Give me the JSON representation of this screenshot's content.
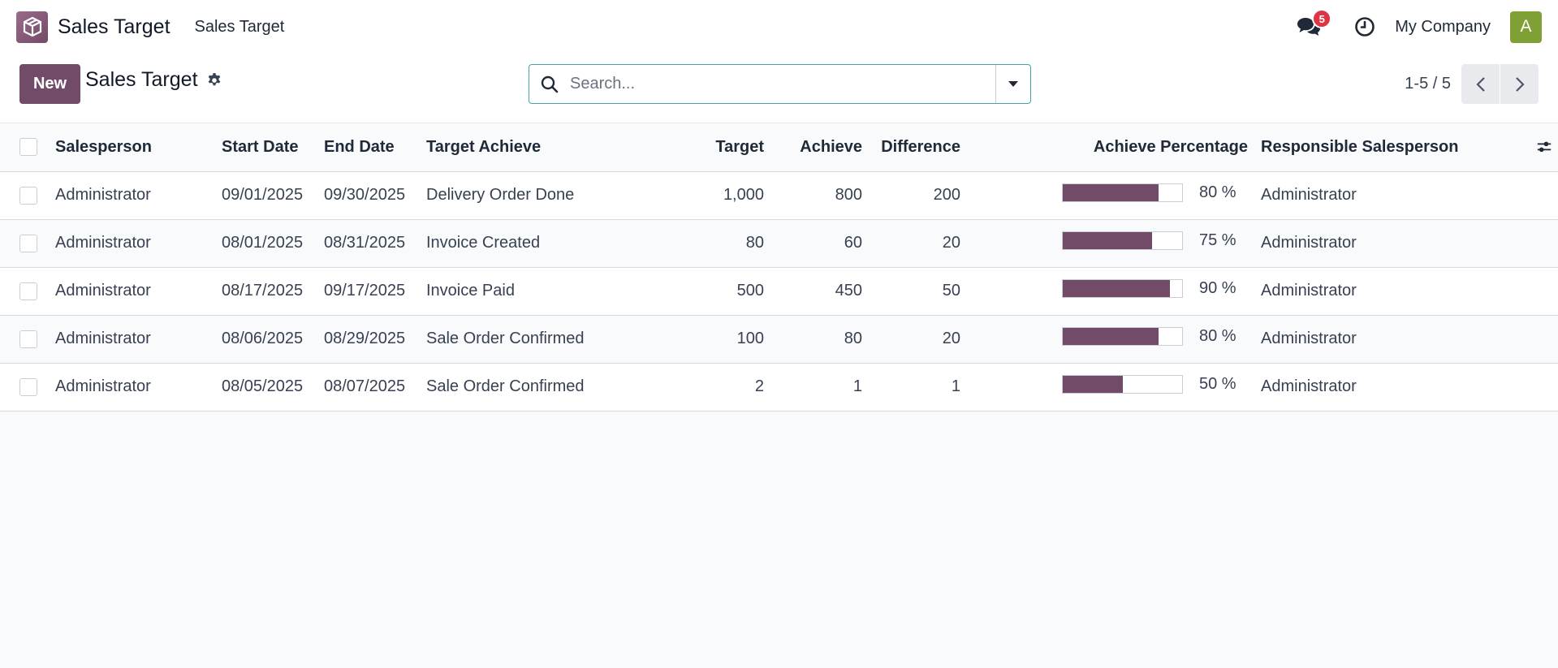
{
  "navbar": {
    "app_name": "Sales Target",
    "menu_item": "Sales Target",
    "chat_badge": "5",
    "company": "My Company",
    "avatar_letter": "A",
    "avatar_color": "#7fa034"
  },
  "control_panel": {
    "new_label": "New",
    "title": "Sales Target",
    "search_placeholder": "Search...",
    "pager_value": "1-5 / 5"
  },
  "colors": {
    "brand": "#714b67",
    "search_focus": "#3fa7a8",
    "badge": "#dc3545"
  },
  "table": {
    "columns": [
      "Salesperson",
      "Start Date",
      "End Date",
      "Target Achieve",
      "Target",
      "Achieve",
      "Difference",
      "Achieve Percentage",
      "Responsible Salesperson"
    ],
    "rows": [
      {
        "salesperson": "Administrator",
        "start": "09/01/2025",
        "end": "09/30/2025",
        "target_achieve": "Delivery Order Done",
        "target": "1,000",
        "achieve": "800",
        "difference": "200",
        "percent": 80,
        "percent_label": "80 %",
        "responsible": "Administrator"
      },
      {
        "salesperson": "Administrator",
        "start": "08/01/2025",
        "end": "08/31/2025",
        "target_achieve": "Invoice Created",
        "target": "80",
        "achieve": "60",
        "difference": "20",
        "percent": 75,
        "percent_label": "75 %",
        "responsible": "Administrator"
      },
      {
        "salesperson": "Administrator",
        "start": "08/17/2025",
        "end": "09/17/2025",
        "target_achieve": "Invoice Paid",
        "target": "500",
        "achieve": "450",
        "difference": "50",
        "percent": 90,
        "percent_label": "90 %",
        "responsible": "Administrator"
      },
      {
        "salesperson": "Administrator",
        "start": "08/06/2025",
        "end": "08/29/2025",
        "target_achieve": "Sale Order Confirmed",
        "target": "100",
        "achieve": "80",
        "difference": "20",
        "percent": 80,
        "percent_label": "80 %",
        "responsible": "Administrator"
      },
      {
        "salesperson": "Administrator",
        "start": "08/05/2025",
        "end": "08/07/2025",
        "target_achieve": "Sale Order Confirmed",
        "target": "2",
        "achieve": "1",
        "difference": "1",
        "percent": 50,
        "percent_label": "50 %",
        "responsible": "Administrator"
      }
    ]
  }
}
